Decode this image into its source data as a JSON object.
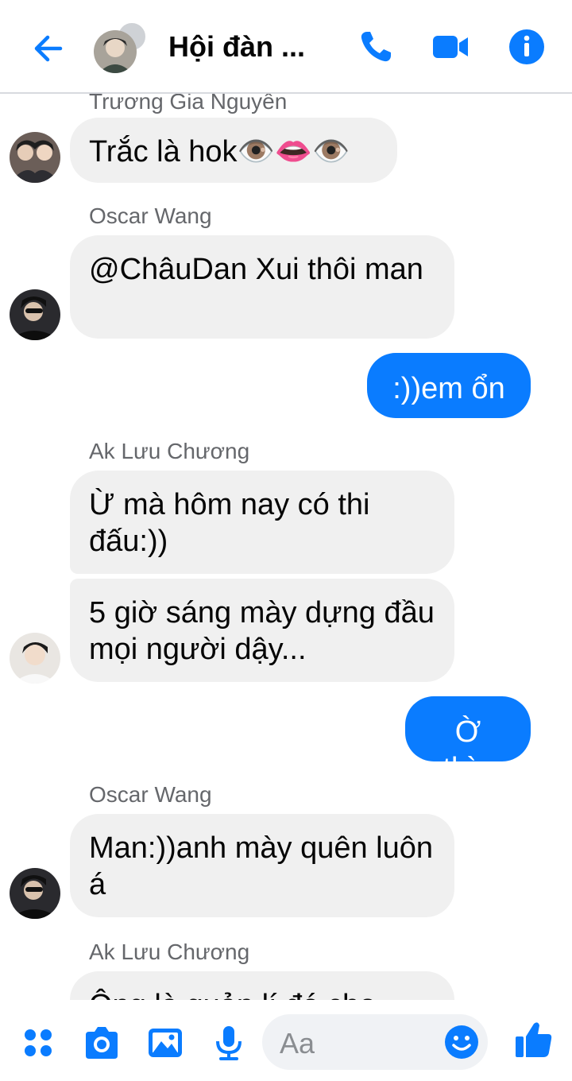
{
  "header": {
    "title": "Hội đàn ...",
    "icons": [
      "back-arrow-icon",
      "phone-icon",
      "video-icon",
      "info-icon"
    ]
  },
  "messages": [
    {
      "sender": "Trương Gia Nguyên",
      "text": "Trắc là hok👁️👄👁️",
      "direction": "incoming"
    },
    {
      "sender": "Oscar Wang",
      "text": "@ChâuDan Xui thôi man",
      "direction": "incoming"
    },
    {
      "text": ":))em ổn",
      "direction": "outgoing"
    },
    {
      "sender": "Ak Lưu Chương",
      "text": "Ừ mà hôm nay có thi đấu:))",
      "direction": "incoming"
    },
    {
      "text": "5 giờ sáng mày dựng đầu mọi người dậy...",
      "direction": "incoming"
    },
    {
      "text": "Ờ thì..",
      "direction": "outgoing"
    },
    {
      "sender": "Oscar Wang",
      "text": "Man:))anh mày quên luôn á",
      "direction": "incoming"
    },
    {
      "sender": "Ak Lưu Chương",
      "text": "Ông là quản lí đó cho",
      "direction": "incoming"
    }
  ],
  "composer": {
    "placeholder": "Aa",
    "icons": [
      "apps-icon",
      "camera-icon",
      "image-icon",
      "microphone-icon",
      "emoji-icon",
      "thumbs-up-icon"
    ]
  },
  "colors": {
    "accent": "#0a7cff",
    "bubble_in": "#f0f0f0",
    "sender_name": "#65676b"
  }
}
